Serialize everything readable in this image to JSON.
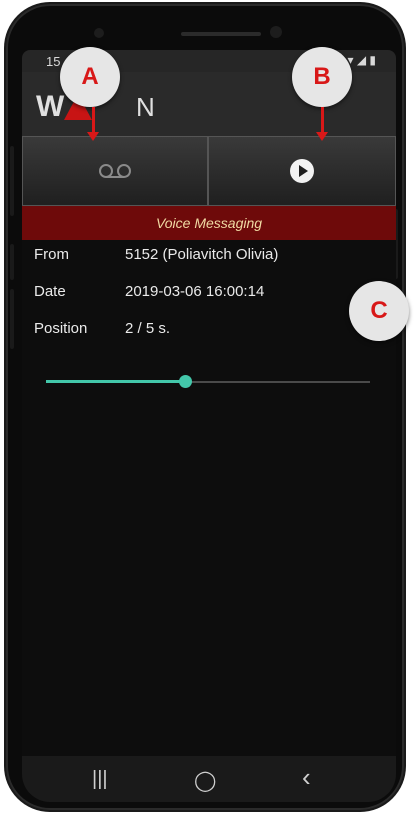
{
  "status_bar": {
    "time": "15",
    "right_icons": "⏰ ▾ ◢ ▮"
  },
  "app": {
    "logo_first": "W",
    "logo_last": "N"
  },
  "toolbar": {
    "voicemail_icon": "voicemail-icon",
    "play_icon": "play-icon"
  },
  "banner": {
    "title": "Voice Messaging"
  },
  "message": {
    "from_label": "From",
    "from_value": "5152 (Poliavitch Olivia)",
    "date_label": "Date",
    "date_value": "2019-03-06 16:00:14",
    "position_label": "Position",
    "position_value": "2 / 5 s."
  },
  "playback": {
    "position_seconds": 2,
    "duration_seconds": 5,
    "progress_fraction": 0.43,
    "accent_color": "#43c7aa"
  },
  "callouts": {
    "a": "A",
    "b": "B",
    "c": "C"
  },
  "nav": {
    "recents": "|||",
    "home": "◯",
    "back": "‹"
  },
  "colors": {
    "banner_bg": "#6e0a0a",
    "banner_text": "#f0d9a3",
    "callout_letter": "#d81818"
  }
}
